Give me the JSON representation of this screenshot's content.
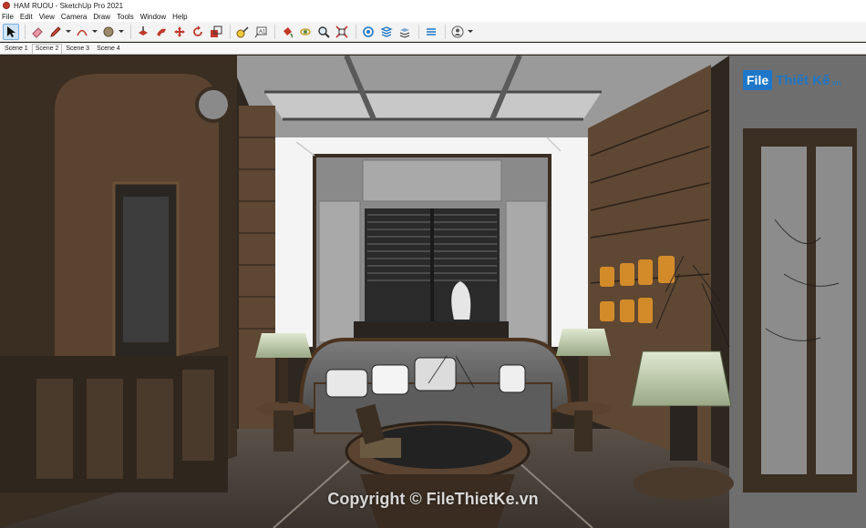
{
  "window": {
    "title": "HAM RUOU - SketchUp Pro 2021"
  },
  "menu": [
    "File",
    "Edit",
    "View",
    "Camera",
    "Draw",
    "Tools",
    "Window",
    "Help"
  ],
  "toolbar": {
    "tools": [
      "select",
      "eraser",
      "pencil",
      "arc",
      "shape",
      "push-pull",
      "follow-me",
      "move",
      "rotate",
      "scale",
      "tape-measure",
      "text",
      "paint-bucket",
      "orbit",
      "pan",
      "zoom",
      "zoom-extents",
      "warehouse",
      "extension",
      "layers",
      "styles",
      "account"
    ],
    "active_tool": "select"
  },
  "scenes": {
    "tabs": [
      "Scene 1",
      "Scene 2",
      "Scene 3",
      "Scene 4"
    ],
    "active": "Scene 2"
  },
  "watermark": {
    "logo_box": "File",
    "logo_text": "Thiết Kế",
    "logo_small": ".vn",
    "copyright": "Copyright © FileThietKe.vn"
  },
  "colors": {
    "accent": "#1e77c8",
    "active_tab_bg": "#cfe3f7",
    "wood_dark": "#3b2e22",
    "wood_mid": "#6b5138",
    "wall_light": "#f2f2f2"
  }
}
